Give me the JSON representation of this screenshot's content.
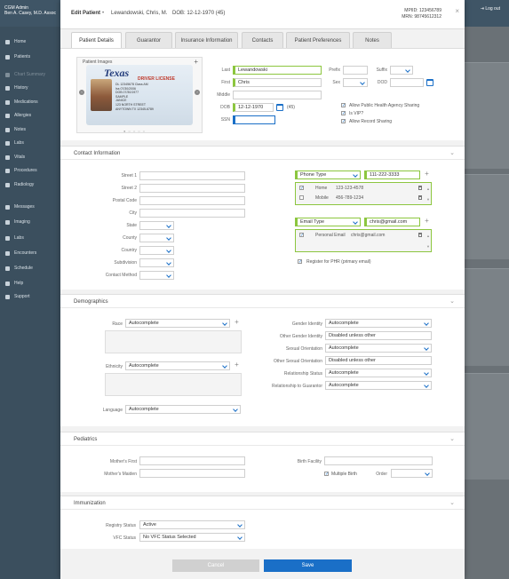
{
  "app": {
    "org": "CGM Admin",
    "user": "Ben A. Casey, M.D. Assoc",
    "logout": "Log out",
    "sidebar": [
      {
        "label": "Home",
        "icon": "home-icon"
      },
      {
        "label": "Patients",
        "icon": "patients-icon"
      },
      {
        "label": "Chart Summary",
        "icon": "chart-icon",
        "dim": true
      },
      {
        "label": "History",
        "icon": "history-icon"
      },
      {
        "label": "Medications",
        "icon": "medications-icon"
      },
      {
        "label": "Allergies",
        "icon": "allergies-icon"
      },
      {
        "label": "Notes",
        "icon": "notes-icon"
      },
      {
        "label": "Labs",
        "icon": "labs-icon"
      },
      {
        "label": "Vitals",
        "icon": "vitals-icon"
      },
      {
        "label": "Procedures",
        "icon": "procedures-icon"
      },
      {
        "label": "Radiology",
        "icon": "radiology-icon"
      },
      {
        "label": "Messages",
        "icon": "messages-icon"
      },
      {
        "label": "Imaging",
        "icon": "imaging-icon"
      },
      {
        "label": "Labs",
        "icon": "labs-icon"
      },
      {
        "label": "Encounters",
        "icon": "encounters-icon"
      },
      {
        "label": "Schedule",
        "icon": "schedule-icon"
      },
      {
        "label": "Help",
        "icon": "help-icon"
      },
      {
        "label": "Support",
        "icon": "support-icon"
      }
    ]
  },
  "modal": {
    "title": "Edit Patient",
    "separator": "•",
    "patient_name": "Lewandowski, Chris, M.",
    "dob_header": "DOB: 12-12-1970 (45)",
    "mpiid": "MPIID: 123456789",
    "mrn": "MRN: 98745612312",
    "close": "×",
    "tabs": [
      "Patient Details",
      "Guarantor",
      "Insurance Information",
      "Contacts",
      "Patient Preferences",
      "Notes"
    ],
    "active_tab": "Patient Details"
  },
  "patient_images": {
    "title": "Patient Images",
    "add": "+",
    "license": {
      "state": "Texas",
      "type": "DRIVER LICENSE",
      "lines": [
        "DL 12345678  Class AM",
        "Iss 07/30/2006",
        "DOB 07/30/1977",
        "SAMPLE",
        "JANICE",
        "123 NORTH STREET",
        "ANYTOWN TX 12345-6789"
      ]
    }
  },
  "identity": {
    "last_label": "Last",
    "last_value": "Lewandowski",
    "first_label": "First",
    "first_value": "Chris",
    "middle_label": "Middle",
    "middle_value": "",
    "dob_label": "DOB",
    "dob_value": "12-12-1970",
    "age": "(45)",
    "ssn_label": "SSN",
    "ssn_value": "",
    "prefix_label": "Prefix",
    "suffix_label": "Suffix",
    "sex_label": "Sex",
    "dod_label": "DOD",
    "checks": [
      {
        "label": "Allow Public Health Agency Sharing",
        "checked": true
      },
      {
        "label": "Is VIP?",
        "checked": true
      },
      {
        "label": "Allow Record Sharing",
        "checked": true
      }
    ]
  },
  "contact": {
    "title": "Contact Information",
    "fields": [
      "Street 1",
      "Street 2",
      "Postal Code",
      "City",
      "State",
      "County",
      "Country",
      "Subdivision",
      "Contact Method"
    ],
    "phone_type": "Phone Type",
    "phone_value": "111-222-3333",
    "phones": [
      {
        "type": "Home",
        "number": "123-123-4578",
        "checked": true
      },
      {
        "type": "Mobile",
        "number": "456-789-1234",
        "checked": false
      }
    ],
    "email_type": "Email Type",
    "email_value": "chris@gmail.com",
    "emails": [
      {
        "type": "Personal Email",
        "address": "chris@gmail.com",
        "checked": true
      }
    ],
    "register_phr": "Register for PHR (primary email)"
  },
  "demographics": {
    "title": "Demographics",
    "race_label": "Race",
    "race_value": "Autocomplete",
    "ethnicity_label": "Ethnicity",
    "ethnicity_value": "Autocomplete",
    "language_label": "Language",
    "language_value": "Autocomplete",
    "right": [
      {
        "label": "Gender Identity",
        "value": "Autocomplete",
        "select": true
      },
      {
        "label": "Other Gender Identity",
        "value": "Disabled unless other",
        "select": false
      },
      {
        "label": "Sexual Orientation",
        "value": "Autocomplete",
        "select": true
      },
      {
        "label": "Other Sexual Orientation",
        "value": "Disabled unless other",
        "select": false
      },
      {
        "label": "Relationship Status",
        "value": "Autocomplete",
        "select": true
      },
      {
        "label": "Relationship to Guarantor",
        "value": "Autocomplete",
        "select": true
      }
    ]
  },
  "pediatrics": {
    "title": "Pediatrics",
    "mothers_first": "Mother's First",
    "mothers_maiden": "Mother's Maiden",
    "birth_facility": "Birth Facility",
    "multiple_birth": "Multiple Birth",
    "order": "Order"
  },
  "immunization": {
    "title": "Immunization",
    "registry_label": "Registry Status",
    "registry_value": "Active",
    "vfc_label": "VFC Status",
    "vfc_value": "No VFC Status Selected"
  },
  "footer": {
    "cancel": "Cancel",
    "save": "Save"
  },
  "colors": {
    "accent": "#1a6fc7",
    "required": "#8cc63f",
    "sidebar": "#3b4f5e"
  }
}
